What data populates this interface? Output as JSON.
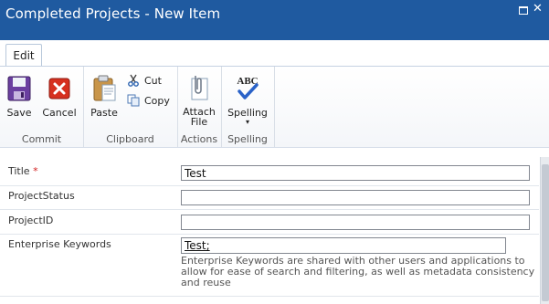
{
  "window": {
    "title": "Completed Projects - New Item"
  },
  "tabs": [
    {
      "label": "Edit"
    }
  ],
  "ribbon": {
    "commit": {
      "label": "Commit",
      "save": "Save",
      "cancel": "Cancel"
    },
    "clipboard": {
      "label": "Clipboard",
      "paste": "Paste",
      "cut": "Cut",
      "copy": "Copy"
    },
    "actions": {
      "label": "Actions",
      "attach_line1": "Attach",
      "attach_line2": "File"
    },
    "spelling": {
      "label": "Spelling",
      "button": "Spelling",
      "icon_text": "ABC"
    }
  },
  "form": {
    "title": {
      "label": "Title",
      "required_mark": "*",
      "value": "Test"
    },
    "project_status": {
      "label": "ProjectStatus",
      "value": ""
    },
    "project_id": {
      "label": "ProjectID",
      "value": ""
    },
    "enterprise_keywords": {
      "label": "Enterprise Keywords",
      "value": "Test;",
      "hint": "Enterprise Keywords are shared with other users and applications to allow for ease of search and filtering, as well as metadata consistency and reuse"
    }
  },
  "colors": {
    "title_bar": "#1f5aa0",
    "required": "#d21e1e"
  },
  "icons": [
    "save-icon",
    "cancel-icon",
    "paste-icon",
    "cut-icon",
    "copy-icon",
    "attach-file-icon",
    "spelling-icon",
    "maximize-icon",
    "close-icon"
  ]
}
